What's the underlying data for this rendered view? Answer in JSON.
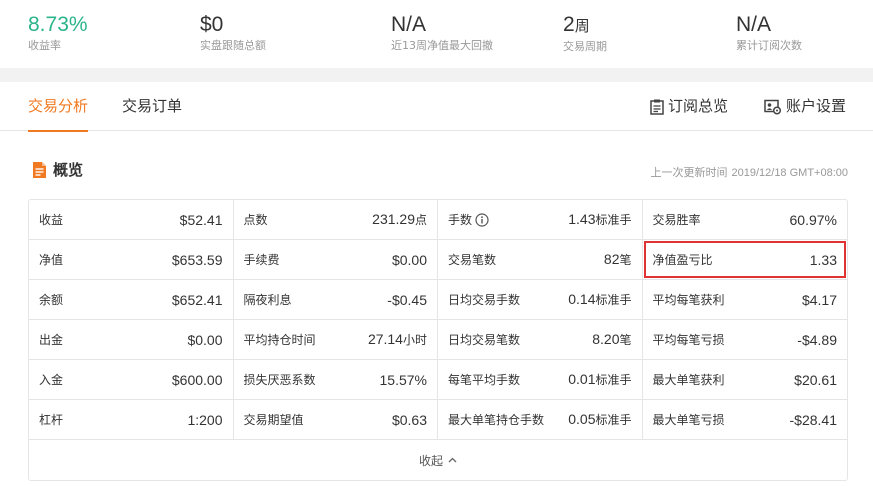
{
  "stats": [
    {
      "value": "8.73%",
      "label": "收益率"
    },
    {
      "value": "$0",
      "label": "实盘跟随总额"
    },
    {
      "value": "N/A",
      "label": "近13周净值最大回撤"
    },
    {
      "value": "2",
      "unit": "周",
      "label": "交易周期"
    },
    {
      "value": "N/A",
      "label": "累计订阅次数"
    }
  ],
  "tabs": [
    {
      "label": "交易分析",
      "active": true
    },
    {
      "label": "交易订单",
      "active": false
    }
  ],
  "tools": {
    "subscriptions": "订阅总览",
    "account_settings": "账户设置"
  },
  "overview": {
    "title": "概览",
    "update_label": "上一次更新时间",
    "update_time": "2019/12/18 GMT+08:00"
  },
  "table": {
    "rows": [
      [
        {
          "key": "收益",
          "value": "$52.41"
        },
        {
          "key": "点数",
          "value": "231.29",
          "unit": "点"
        },
        {
          "key": "手数",
          "value": "1.43",
          "unit": "标准手",
          "info": true
        },
        {
          "key": "交易胜率",
          "value": "60.97%"
        }
      ],
      [
        {
          "key": "净值",
          "value": "$653.59"
        },
        {
          "key": "手续费",
          "value": "$0.00"
        },
        {
          "key": "交易笔数",
          "value": "82",
          "unit": "笔"
        },
        {
          "key": "净值盈亏比",
          "value": "1.33"
        }
      ],
      [
        {
          "key": "余额",
          "value": "$652.41"
        },
        {
          "key": "隔夜利息",
          "value": "-$0.45"
        },
        {
          "key": "日均交易手数",
          "value": "0.14",
          "unit": "标准手"
        },
        {
          "key": "平均每笔获利",
          "value": "$4.17"
        }
      ],
      [
        {
          "key": "出金",
          "value": "$0.00"
        },
        {
          "key": "平均持仓时间",
          "value": "27.14",
          "unit": "小时"
        },
        {
          "key": "日均交易笔数",
          "value": "8.20",
          "unit": "笔"
        },
        {
          "key": "平均每笔亏损",
          "value": "-$4.89"
        }
      ],
      [
        {
          "key": "入金",
          "value": "$600.00"
        },
        {
          "key": "损失厌恶系数",
          "value": "15.57%"
        },
        {
          "key": "每笔平均手数",
          "value": "0.01",
          "unit": "标准手"
        },
        {
          "key": "最大单笔获利",
          "value": "$20.61"
        }
      ],
      [
        {
          "key": "杠杆",
          "value": "1:200"
        },
        {
          "key": "交易期望值",
          "value": "$0.63"
        },
        {
          "key": "最大单笔持仓手数",
          "value": "0.05",
          "unit": "标准手"
        },
        {
          "key": "最大单笔亏损",
          "value": "-$28.41"
        }
      ]
    ],
    "collapse_label": "收起"
  },
  "colors": {
    "accent": "#f07922",
    "positive": "#2bb48a",
    "highlight_border": "#e03434"
  },
  "icons": {
    "overview": "document-icon",
    "subscriptions": "clipboard-icon",
    "account_settings": "account-settings-icon",
    "info": "info-icon",
    "collapse": "chevron-up-icon"
  }
}
